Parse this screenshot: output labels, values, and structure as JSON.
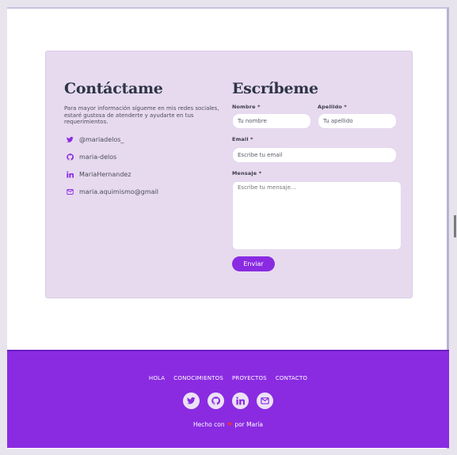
{
  "contact": {
    "title": "Contáctame",
    "intro": "Para mayor información sígueme en mis redes sociales, estaré gustosa de atenderte y ayudarte en tus requerimientos.",
    "socials": [
      {
        "icon": "twitter-icon",
        "label": "@mariadelos_"
      },
      {
        "icon": "github-icon",
        "label": "maria-delos"
      },
      {
        "icon": "linkedin-icon",
        "label": "MariaHernandez"
      },
      {
        "icon": "email-icon",
        "label": "maria.aquimismo@gmail"
      }
    ]
  },
  "form": {
    "title": "Escríbeme",
    "nombre_label": "Nombre *",
    "nombre_placeholder": "Tu nombre",
    "apellido_label": "Apellido *",
    "apellido_placeholder": "Tu apellido",
    "email_label": "Email *",
    "email_placeholder": "Escribe tu email",
    "mensaje_label": "Mensaje *",
    "mensaje_placeholder": "Escribe tu mensaje...",
    "submit_label": "Enviar"
  },
  "footer": {
    "nav": [
      "HOLA",
      "CONOCIMIENTOS",
      "PROYECTOS",
      "CONTACTO"
    ],
    "icons": [
      "twitter-icon",
      "github-icon",
      "linkedin-icon",
      "email-icon"
    ],
    "credit_prefix": "Hecho con",
    "credit_suffix": "por María"
  },
  "colors": {
    "accent": "#8a2be2",
    "card_bg": "#e7daef",
    "heading": "#2e3547",
    "heart": "#e0324b"
  }
}
